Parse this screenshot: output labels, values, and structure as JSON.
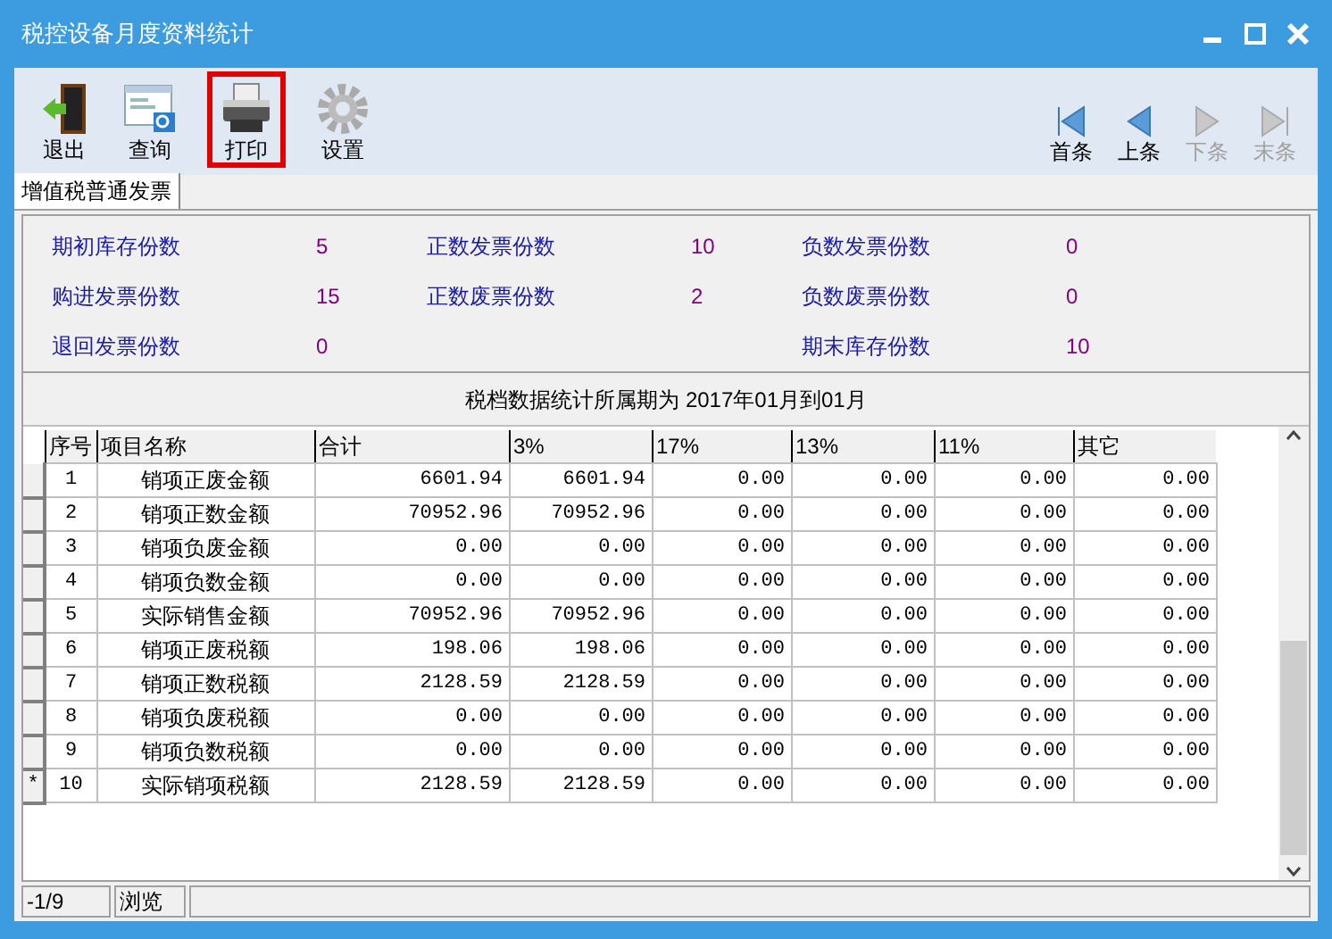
{
  "window": {
    "title": "税控设备月度资料统计"
  },
  "toolbar": [
    {
      "label": "退出",
      "kind": "exit",
      "highlighted": false
    },
    {
      "label": "查询",
      "kind": "query",
      "highlighted": false
    },
    {
      "label": "打印",
      "kind": "print",
      "highlighted": true
    },
    {
      "label": "设置",
      "kind": "settings",
      "highlighted": false
    }
  ],
  "navigation": [
    {
      "label": "首条",
      "kind": "first",
      "disabled": false
    },
    {
      "label": "上条",
      "kind": "prev",
      "disabled": false
    },
    {
      "label": "下条",
      "kind": "next",
      "disabled": true
    },
    {
      "label": "末条",
      "kind": "last",
      "disabled": true
    }
  ],
  "tabs": [
    {
      "label": "增值税普通发票",
      "selected": true
    }
  ],
  "stats": [
    {
      "items": [
        {
          "label": "期初库存份数",
          "value": "5"
        },
        {
          "label": "购进发票份数",
          "value": "15"
        },
        {
          "label": "退回发票份数",
          "value": "0"
        }
      ]
    },
    {
      "items": [
        {
          "label": "正数发票份数",
          "value": "10"
        },
        {
          "label": "正数废票份数",
          "value": "2"
        }
      ]
    },
    {
      "items": [
        {
          "label": "负数发票份数",
          "value": "0"
        },
        {
          "label": "负数废票份数",
          "value": "0"
        },
        {
          "label": "期末库存份数",
          "value": "10"
        }
      ]
    }
  ],
  "period": "税档数据统计所属期为 2017年01月到01月",
  "table": {
    "columns": [
      "序号",
      "项目名称",
      "合计",
      "3%",
      "17%",
      "13%",
      "11%",
      "其它"
    ],
    "rows": [
      {
        "cells": [
          "1",
          "销项正废金额",
          "6601.94",
          "6601.94",
          "0.00",
          "0.00",
          "0.00",
          "0.00"
        ]
      },
      {
        "cells": [
          "2",
          "销项正数金额",
          "70952.96",
          "70952.96",
          "0.00",
          "0.00",
          "0.00",
          "0.00"
        ]
      },
      {
        "cells": [
          "3",
          "销项负废金额",
          "0.00",
          "0.00",
          "0.00",
          "0.00",
          "0.00",
          "0.00"
        ]
      },
      {
        "cells": [
          "4",
          "销项负数金额",
          "0.00",
          "0.00",
          "0.00",
          "0.00",
          "0.00",
          "0.00"
        ]
      },
      {
        "cells": [
          "5",
          "实际销售金额",
          "70952.96",
          "70952.96",
          "0.00",
          "0.00",
          "0.00",
          "0.00"
        ]
      },
      {
        "cells": [
          "6",
          "销项正废税额",
          "198.06",
          "198.06",
          "0.00",
          "0.00",
          "0.00",
          "0.00"
        ]
      },
      {
        "cells": [
          "7",
          "销项正数税额",
          "2128.59",
          "2128.59",
          "0.00",
          "0.00",
          "0.00",
          "0.00"
        ]
      },
      {
        "cells": [
          "8",
          "销项负废税额",
          "0.00",
          "0.00",
          "0.00",
          "0.00",
          "0.00",
          "0.00"
        ]
      },
      {
        "cells": [
          "9",
          "销项负数税额",
          "0.00",
          "0.00",
          "0.00",
          "0.00",
          "0.00",
          "0.00"
        ]
      },
      {
        "cells": [
          "10",
          "实际销项税额",
          "2128.59",
          "2128.59",
          "0.00",
          "0.00",
          "0.00",
          "0.00"
        ],
        "marker": "*"
      }
    ]
  },
  "status_bar": [
    "-1/9",
    "浏览"
  ]
}
